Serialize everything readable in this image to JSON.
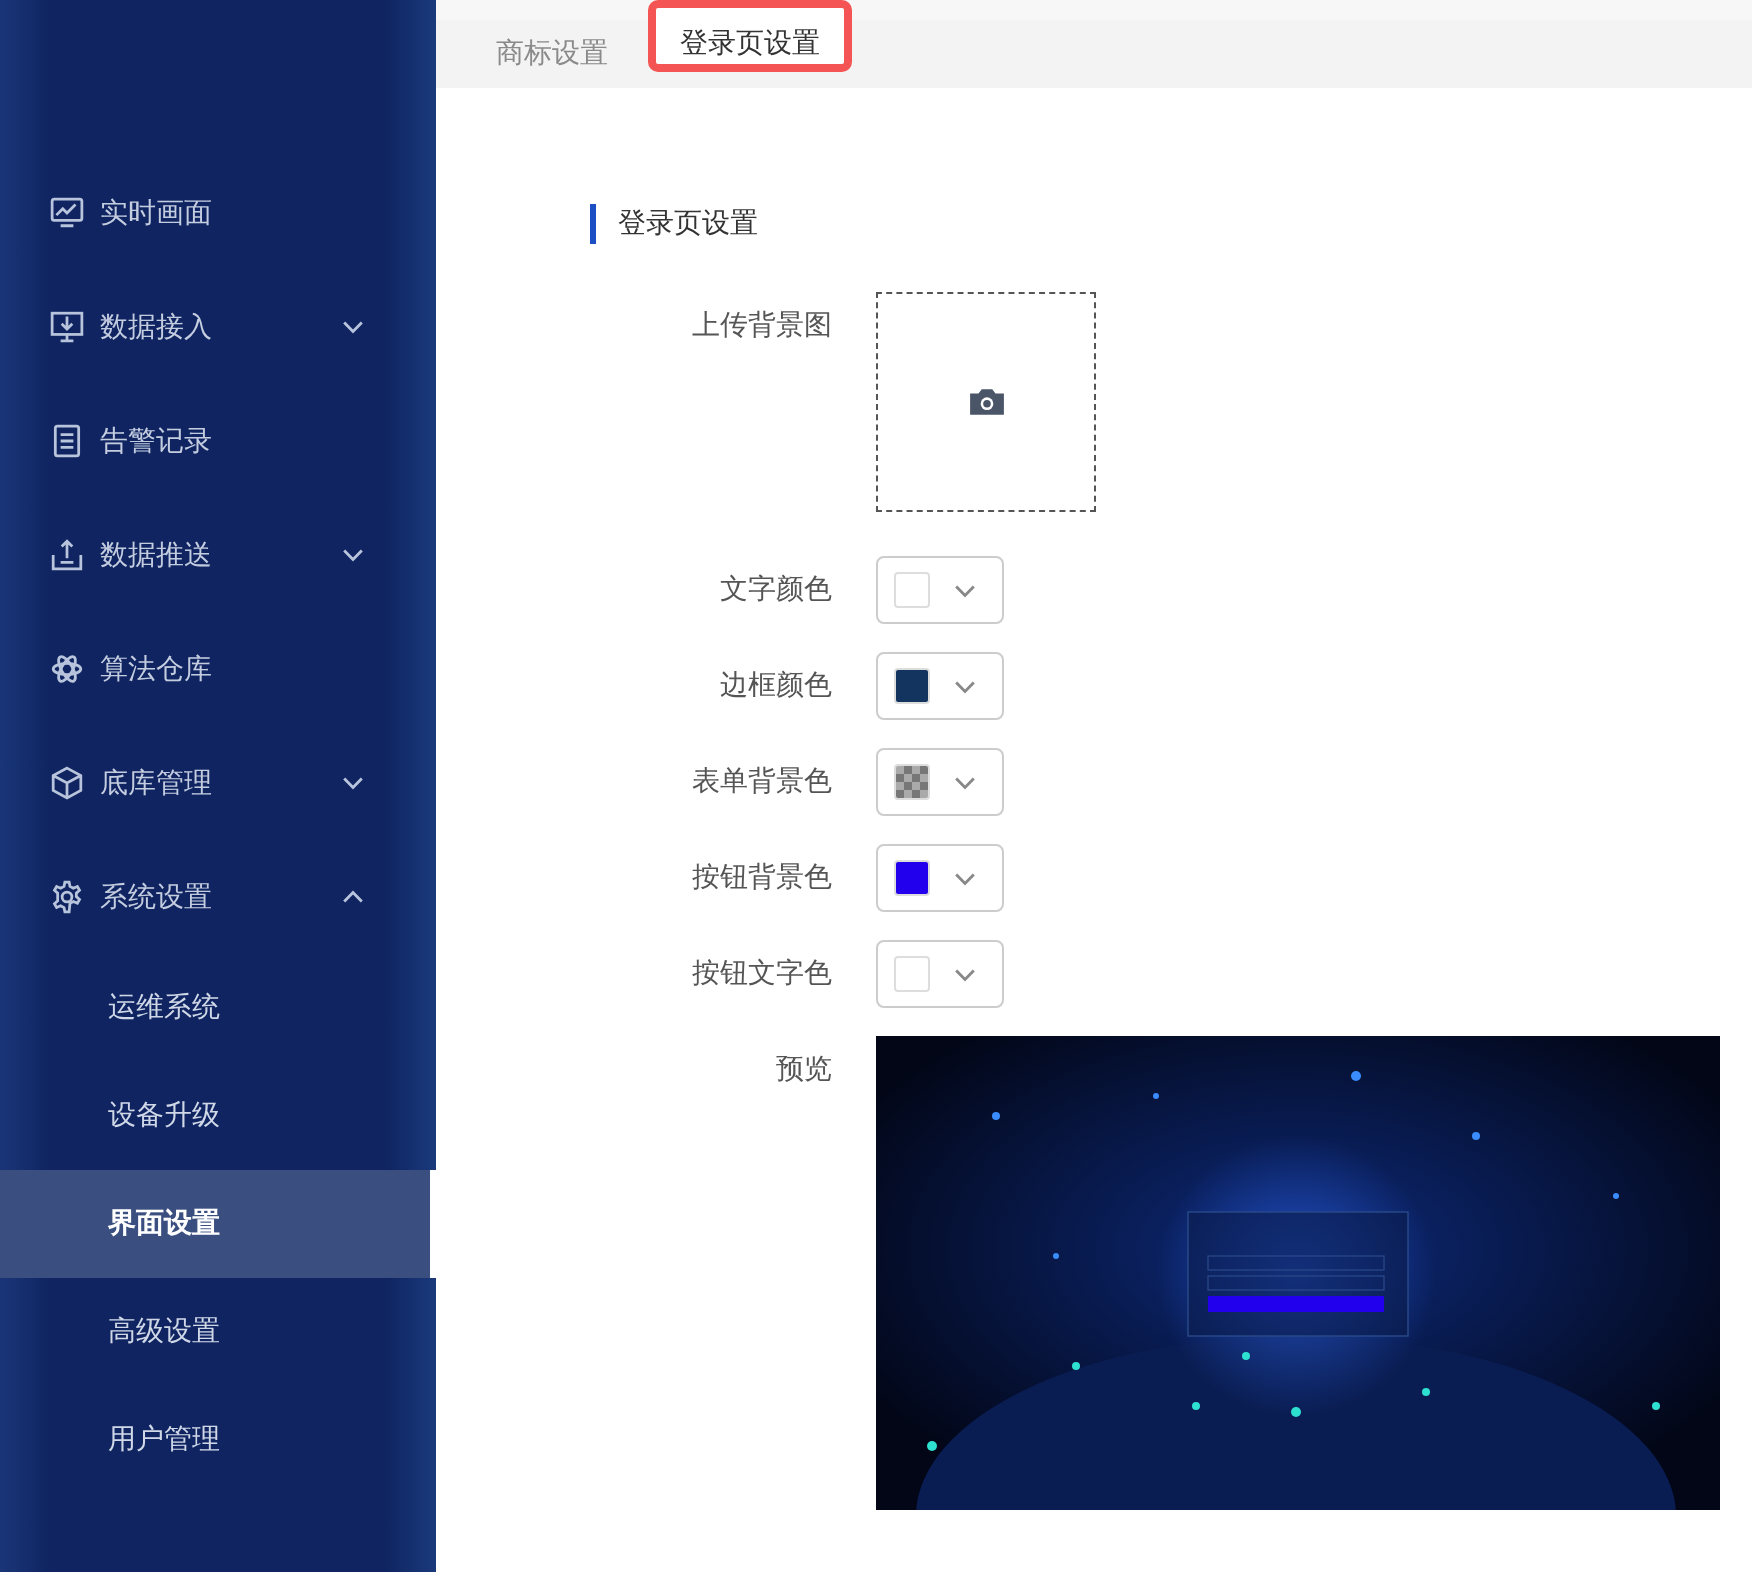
{
  "sidebar": {
    "items": [
      {
        "label": "实时画面",
        "kind": "link"
      },
      {
        "label": "数据接入",
        "kind": "group",
        "expanded": false
      },
      {
        "label": "告警记录",
        "kind": "link"
      },
      {
        "label": "数据推送",
        "kind": "group",
        "expanded": false
      },
      {
        "label": "算法仓库",
        "kind": "link"
      },
      {
        "label": "底库管理",
        "kind": "group",
        "expanded": false
      },
      {
        "label": "系统设置",
        "kind": "group",
        "expanded": true,
        "children": [
          {
            "label": "运维系统",
            "selected": false
          },
          {
            "label": "设备升级",
            "selected": false
          },
          {
            "label": "界面设置",
            "selected": true
          },
          {
            "label": "高级设置",
            "selected": false
          },
          {
            "label": "用户管理",
            "selected": false
          }
        ]
      }
    ]
  },
  "tabs": [
    {
      "label": "商标设置",
      "selected": false
    },
    {
      "label": "登录页设置",
      "selected": true
    }
  ],
  "section_title": "登录页设置",
  "upload": {
    "label": "上传背景图"
  },
  "color_fields": [
    {
      "label": "文字颜色",
      "kind": "solid",
      "color": "#ffffff"
    },
    {
      "label": "边框颜色",
      "kind": "solid",
      "color": "#12345e"
    },
    {
      "label": "表单背景色",
      "kind": "transparent"
    },
    {
      "label": "按钮背景色",
      "kind": "solid",
      "color": "#2200ee"
    },
    {
      "label": "按钮文字色",
      "kind": "solid",
      "color": "#ffffff"
    }
  ],
  "preview": {
    "label": "预览"
  }
}
